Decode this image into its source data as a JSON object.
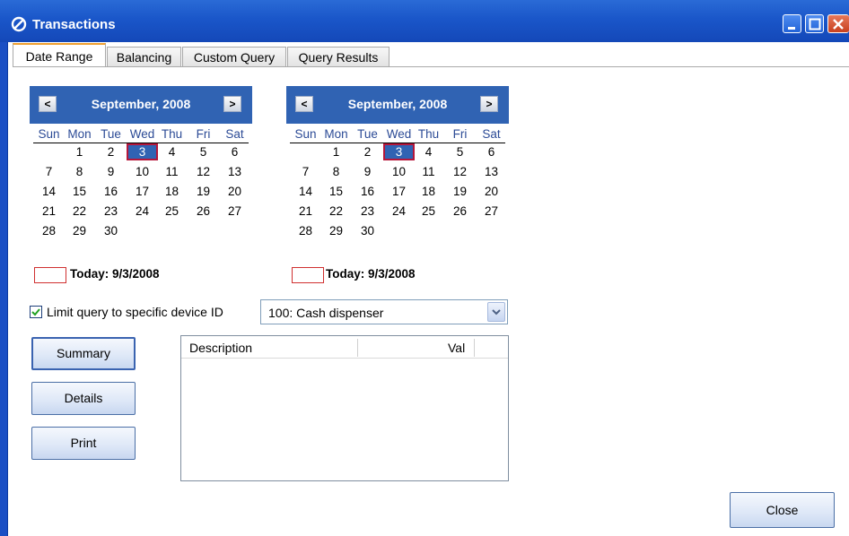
{
  "window": {
    "title": "Transactions",
    "icon": "no-entry-icon",
    "accent": "#1a56c9"
  },
  "tabs": [
    {
      "label": "Date Range",
      "active": true
    },
    {
      "label": "Balancing",
      "active": false
    },
    {
      "label": "Custom Query",
      "active": false
    },
    {
      "label": "Query Results",
      "active": false
    }
  ],
  "calendars": [
    {
      "month_label": "September, 2008",
      "prev_glyph": "<",
      "next_glyph": ">",
      "dow": [
        "Sun",
        "Mon",
        "Tue",
        "Wed",
        "Thu",
        "Fri",
        "Sat"
      ],
      "weeks": [
        [
          "",
          "1",
          "2",
          "3",
          "4",
          "5",
          "6"
        ],
        [
          "7",
          "8",
          "9",
          "10",
          "11",
          "12",
          "13"
        ],
        [
          "14",
          "15",
          "16",
          "17",
          "18",
          "19",
          "20"
        ],
        [
          "21",
          "22",
          "23",
          "24",
          "25",
          "26",
          "27"
        ],
        [
          "28",
          "29",
          "30",
          "",
          "",
          "",
          ""
        ]
      ],
      "selected_day": "3",
      "today_label": "Today: 9/3/2008"
    },
    {
      "month_label": "September, 2008",
      "prev_glyph": "<",
      "next_glyph": ">",
      "dow": [
        "Sun",
        "Mon",
        "Tue",
        "Wed",
        "Thu",
        "Fri",
        "Sat"
      ],
      "weeks": [
        [
          "",
          "1",
          "2",
          "3",
          "4",
          "5",
          "6"
        ],
        [
          "7",
          "8",
          "9",
          "10",
          "11",
          "12",
          "13"
        ],
        [
          "14",
          "15",
          "16",
          "17",
          "18",
          "19",
          "20"
        ],
        [
          "21",
          "22",
          "23",
          "24",
          "25",
          "26",
          "27"
        ],
        [
          "28",
          "29",
          "30",
          "",
          "",
          "",
          ""
        ]
      ],
      "selected_day": "3",
      "today_label": "Today: 9/3/2008"
    }
  ],
  "device_filter": {
    "checked": true,
    "label": "Limit query to specific device ID",
    "selected_value": "100: Cash dispenser"
  },
  "actions": {
    "summary": "Summary",
    "details": "Details",
    "print": "Print",
    "close": "Close"
  },
  "results_table": {
    "columns": [
      "Description",
      "Val"
    ],
    "rows": []
  },
  "colors": {
    "calendar_header": "#3063b3",
    "selection_border": "#b5163a",
    "today_marker": "#d03030",
    "active_tab_accent": "#f0a030"
  }
}
